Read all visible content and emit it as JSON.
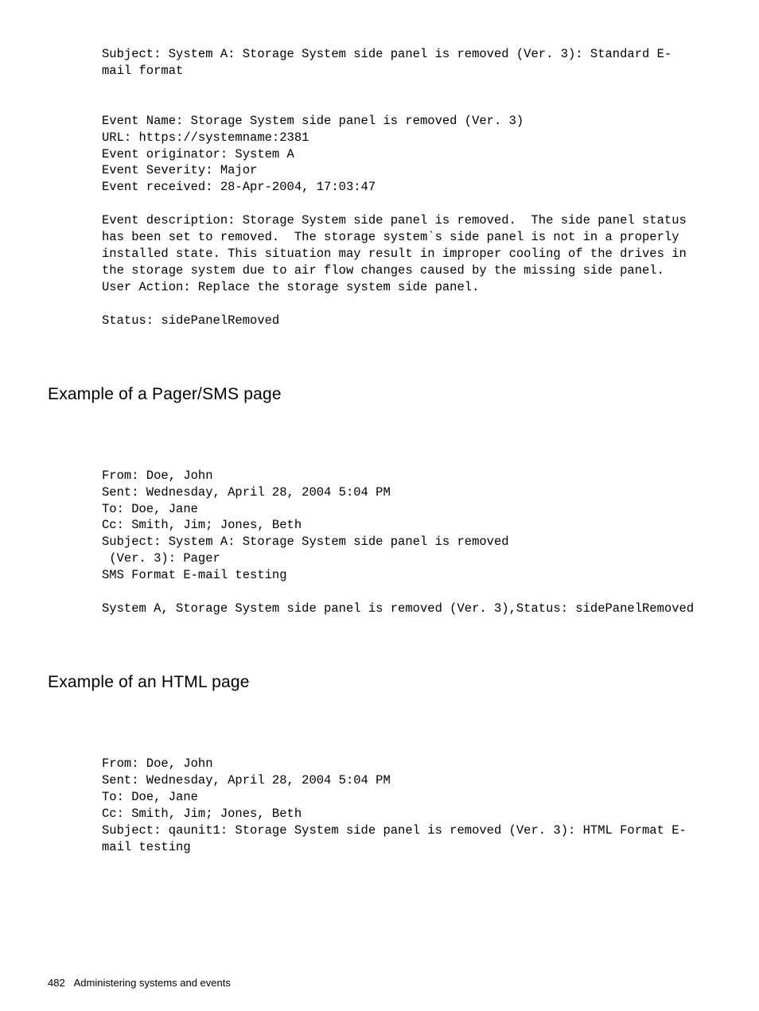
{
  "block1": "Subject: System A: Storage System side panel is removed (Ver. 3): Standard E-mail format\n\n\nEvent Name: Storage System side panel is removed (Ver. 3)\nURL: https://systemname:2381\nEvent originator: System A\nEvent Severity: Major\nEvent received: 28-Apr-2004, 17:03:47\n\nEvent description: Storage System side panel is removed.  The side panel status has been set to removed.  The storage system`s side panel is not in a properly installed state. This situation may result in improper cooling of the drives in the storage system due to air flow changes caused by the missing side panel.\nUser Action: Replace the storage system side panel.\n\nStatus: sidePanelRemoved",
  "heading1": "Example of a Pager/SMS page",
  "block2": "From: Doe, John\nSent: Wednesday, April 28, 2004 5:04 PM\nTo: Doe, Jane\nCc: Smith, Jim; Jones, Beth\nSubject: System A: Storage System side panel is removed\n (Ver. 3): Pager\nSMS Format E-mail testing\n\nSystem A, Storage System side panel is removed (Ver. 3),Status: sidePanelRemoved",
  "heading2": "Example of an HTML page",
  "block3": "From: Doe, John\nSent: Wednesday, April 28, 2004 5:04 PM\nTo: Doe, Jane\nCc: Smith, Jim; Jones, Beth\nSubject: qaunit1: Storage System side panel is removed (Ver. 3): HTML Format E-mail testing",
  "footer": {
    "page_number": "482",
    "section_title": "Administering systems and events"
  }
}
